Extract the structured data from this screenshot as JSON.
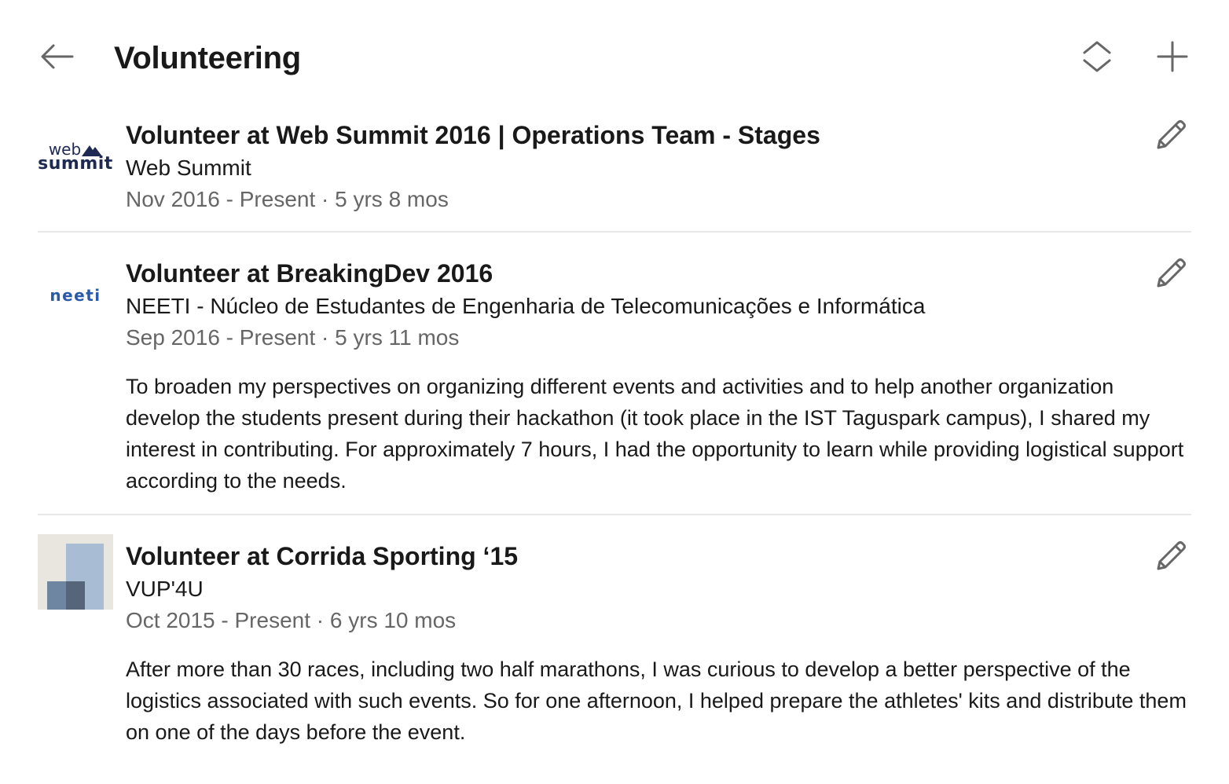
{
  "header": {
    "title": "Volunteering",
    "back_icon": "arrow-left-icon",
    "reorder_icon": "reorder-icon",
    "add_icon": "plus-icon"
  },
  "entries": [
    {
      "role": "Volunteer at Web Summit 2016 | Operations Team - Stages",
      "organization": "Web Summit",
      "dates": "Nov 2016 - Present · 5 yrs 8 mos",
      "description": "",
      "logo": {
        "line1": "web",
        "line2": "summit"
      }
    },
    {
      "role": "Volunteer at BreakingDev 2016",
      "organization": "NEETI - Núcleo de Estudantes de Engenharia de Telecomunicações e Informática",
      "dates": "Sep 2016 - Present · 5 yrs 11 mos",
      "description": "To broaden my perspectives on organizing different events and activities and to help another organization develop the students present during their hackathon (it took place in the IST Taguspark campus), I shared my interest in contributing. For approximately 7 hours, I had the opportunity to learn while providing logistical support according to the needs.",
      "logo": {
        "text": "neeti"
      }
    },
    {
      "role": "Volunteer at Corrida Sporting ‘15",
      "organization": "VUP'4U",
      "dates": "Oct 2015 - Present · 6 yrs 10 mos",
      "description": "After more than 30 races, including two half marathons, I was curious to develop a better perspective of the logistics associated with such events. So for one afternoon, I helped prepare the athletes' kits and distribute them on one of the days before the event.",
      "logo": {
        "icon": "placeholder-company-icon"
      }
    }
  ],
  "colors": {
    "text_primary": "#191919",
    "text_secondary": "#666666",
    "icon": "#666666",
    "divider": "#e8e8e8",
    "websummit_navy": "#1e2a52",
    "neeti_blue": "#2b5aa8"
  }
}
